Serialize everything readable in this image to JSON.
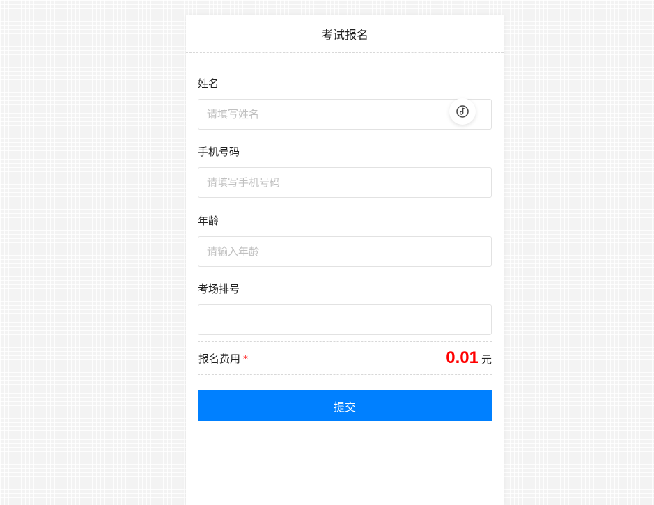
{
  "header": {
    "title": "考试报名"
  },
  "form": {
    "name": {
      "label": "姓名",
      "placeholder": "请填写姓名",
      "value": ""
    },
    "phone": {
      "label": "手机号码",
      "placeholder": "请填写手机号码",
      "value": ""
    },
    "age": {
      "label": "年龄",
      "placeholder": "请输入年龄",
      "value": ""
    },
    "seat": {
      "label": "考场排号",
      "placeholder": "",
      "value": ""
    },
    "fee": {
      "label": "报名费用",
      "required_mark": "*",
      "amount": "0.01",
      "unit": "元"
    },
    "submit_label": "提交"
  },
  "icons": {
    "float_button": "music-disc-icon"
  },
  "colors": {
    "primary": "#0080ff",
    "price": "#ff0000",
    "required": "#ff2a2a"
  }
}
